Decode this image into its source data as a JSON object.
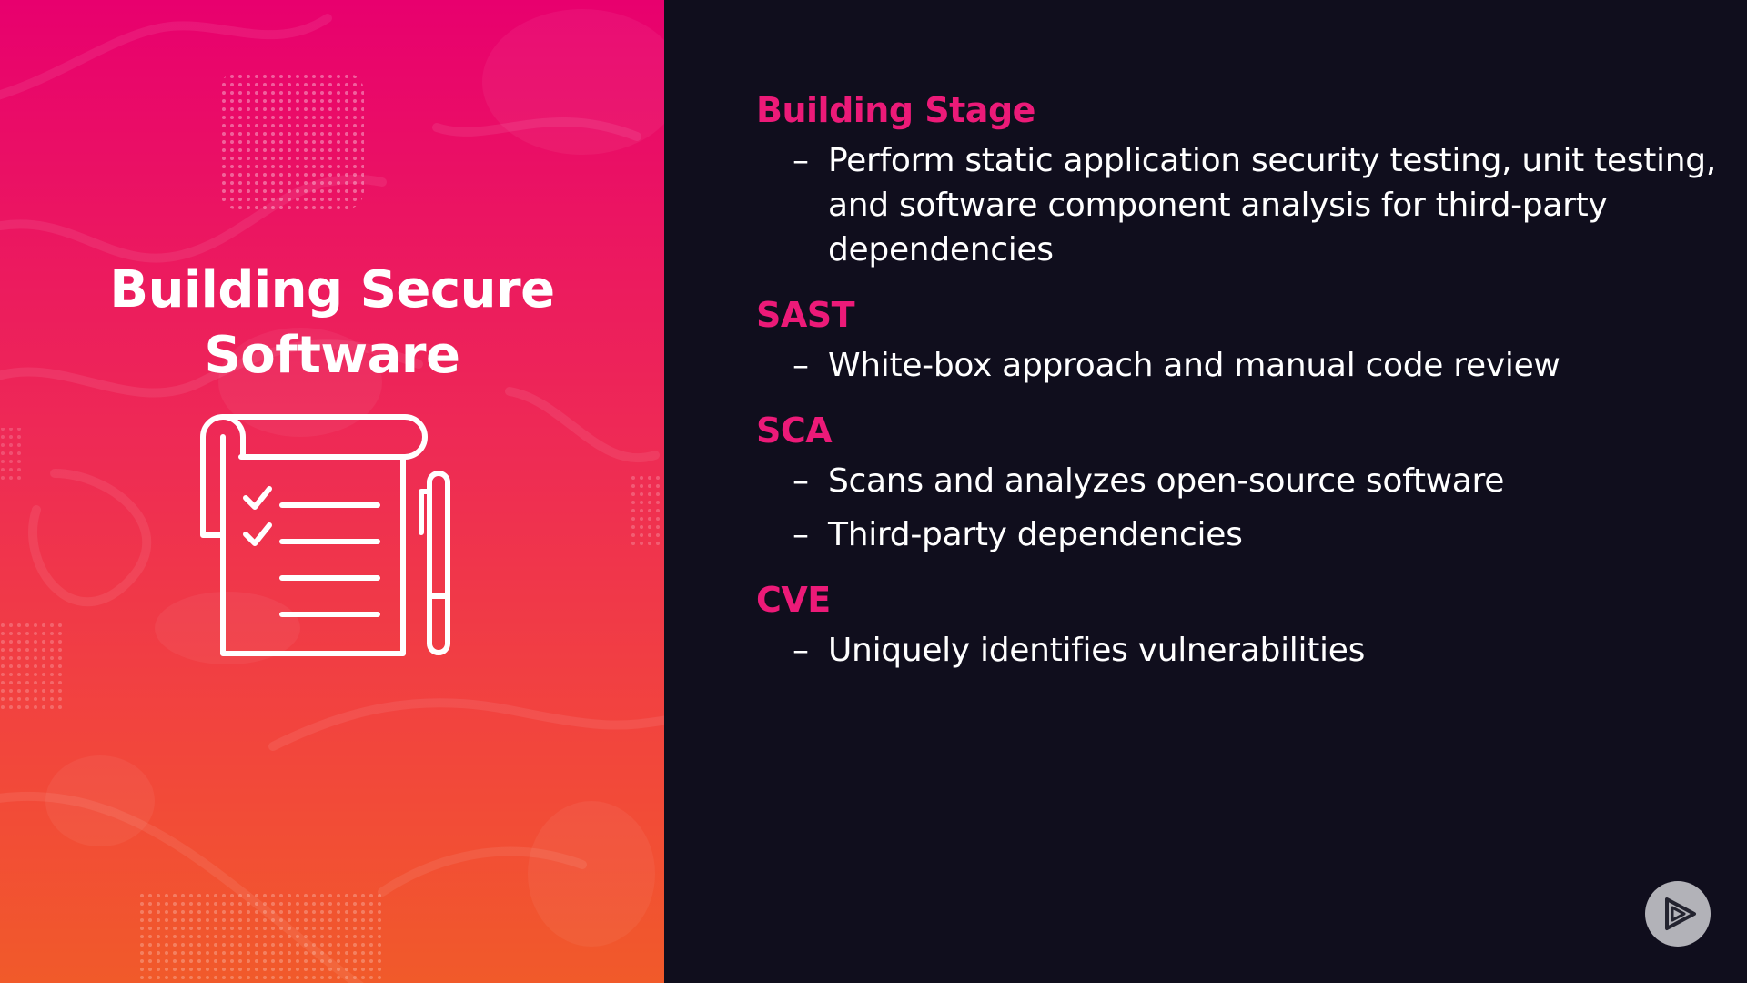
{
  "slide": {
    "title_lines": [
      "Building Secure",
      "Software"
    ],
    "accent_color": "#ec1a78",
    "left_gradient": [
      "#e8006e",
      "#ee2a55",
      "#f2453d",
      "#f15a2a"
    ],
    "right_background": "#100e1d",
    "illustration_icon": "checklist-with-pen-icon",
    "sections": [
      {
        "heading": "Building Stage",
        "bullets": [
          "Perform static application security testing, unit testing, and software component analysis for third-party dependencies"
        ]
      },
      {
        "heading": "SAST",
        "bullets": [
          "White-box approach and manual code review"
        ]
      },
      {
        "heading": "SCA",
        "bullets": [
          "Scans and analyzes open-source software",
          "Third-party dependencies"
        ]
      },
      {
        "heading": "CVE",
        "bullets": [
          "Uniquely identifies vulnerabilities"
        ]
      }
    ],
    "bullet_marker": "–",
    "brand_icon": "play-logo-icon"
  }
}
